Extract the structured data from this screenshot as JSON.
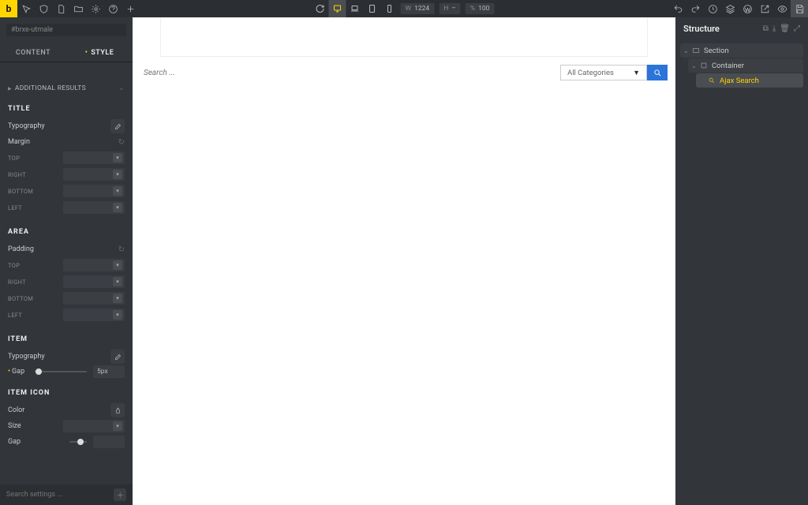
{
  "topbar": {
    "logo": "b",
    "dims": {
      "w_label": "W",
      "w_value": "1224",
      "h_label": "H",
      "h_value": "–",
      "pct_label": "%",
      "pct_value": "100"
    }
  },
  "left": {
    "element_id": "#brxe-utmale",
    "tabs": {
      "content": "CONTENT",
      "style": "STYLE"
    },
    "accordion": "ADDITIONAL RESULTS",
    "sections": {
      "title": {
        "heading": "TITLE",
        "typography": "Typography",
        "margin": "Margin",
        "sides": {
          "top": "TOP",
          "right": "RIGHT",
          "bottom": "BOTTOM",
          "left": "LEFT"
        }
      },
      "area": {
        "heading": "AREA",
        "padding": "Padding",
        "sides": {
          "top": "TOP",
          "right": "RIGHT",
          "bottom": "BOTTOM",
          "left": "LEFT"
        }
      },
      "item": {
        "heading": "ITEM",
        "typography": "Typography",
        "gap": "Gap",
        "gap_value": "5px"
      },
      "item_icon": {
        "heading": "ITEM ICON",
        "color": "Color",
        "size": "Size",
        "gap": "Gap"
      }
    },
    "search_placeholder": "Search settings ..."
  },
  "canvas": {
    "search_placeholder": "Search ...",
    "category": "All Categories"
  },
  "right": {
    "title": "Structure",
    "tree": [
      {
        "name": "Section",
        "depth": 0,
        "icon": "section",
        "sel": false
      },
      {
        "name": "Container",
        "depth": 1,
        "icon": "container",
        "sel": false
      },
      {
        "name": "Ajax Search",
        "depth": 2,
        "icon": "search",
        "sel": true
      }
    ]
  }
}
